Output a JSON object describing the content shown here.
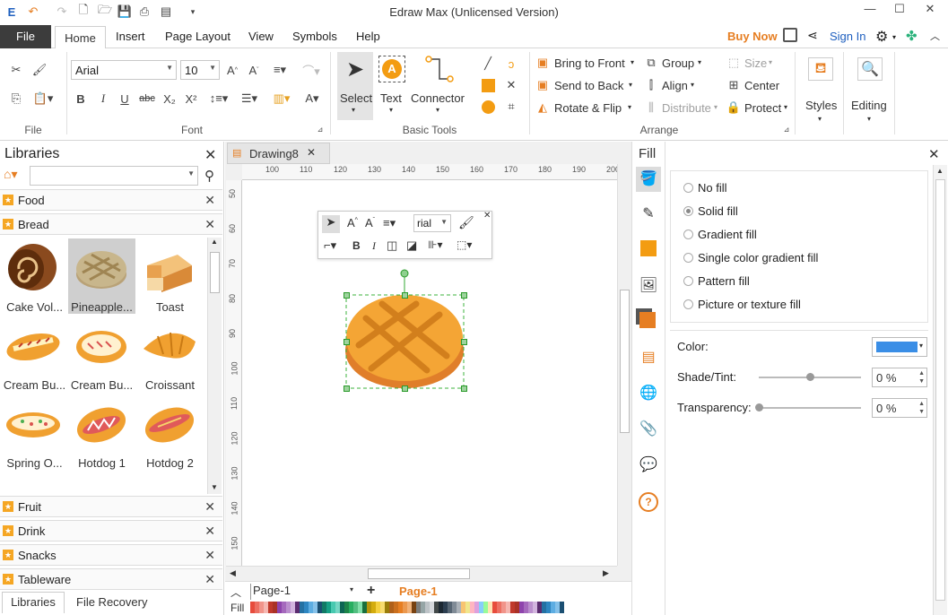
{
  "window": {
    "title": "Edraw Max (Unlicensed Version)"
  },
  "menu": {
    "file": "File",
    "tabs": [
      "Home",
      "Insert",
      "Page Layout",
      "View",
      "Symbols",
      "Help"
    ],
    "buy_now": "Buy Now",
    "sign_in": "Sign In"
  },
  "ribbon": {
    "file_group": "File",
    "font": {
      "family": "Arial",
      "size": "10",
      "group_label": "Font"
    },
    "basic_tools": {
      "select": "Select",
      "text": "Text",
      "connector": "Connector",
      "group_label": "Basic Tools"
    },
    "arrange": {
      "bring_front": "Bring to Front",
      "send_back": "Send to Back",
      "rotate_flip": "Rotate & Flip",
      "group": "Group",
      "align": "Align",
      "distribute": "Distribute",
      "size": "Size",
      "center": "Center",
      "protect": "Protect",
      "group_label": "Arrange"
    },
    "styles": "Styles",
    "editing": "Editing"
  },
  "libraries": {
    "title": "Libraries",
    "search_placeholder": "",
    "categories_top": [
      "Food",
      "Bread"
    ],
    "shapes": [
      {
        "label": "Cake Vol...",
        "icon": "cake-roll-icon"
      },
      {
        "label": "Pineapple...",
        "icon": "pineapple-bun-icon"
      },
      {
        "label": "Toast",
        "icon": "toast-icon"
      },
      {
        "label": "Cream Bu...",
        "icon": "cream-bun-icon"
      },
      {
        "label": "Cream Bu...",
        "icon": "cream-bun-2-icon"
      },
      {
        "label": "Croissant",
        "icon": "croissant-icon"
      },
      {
        "label": "Spring O...",
        "icon": "spring-onion-bun-icon"
      },
      {
        "label": "Hotdog 1",
        "icon": "hotdog-1-icon"
      },
      {
        "label": "Hotdog 2",
        "icon": "hotdog-2-icon"
      }
    ],
    "categories_bottom": [
      "Fruit",
      "Drink",
      "Snacks",
      "Tableware"
    ],
    "bottom_tabs": [
      "Libraries",
      "File Recovery"
    ]
  },
  "document": {
    "tab": "Drawing8",
    "ruler_h": [
      "100",
      "110",
      "120",
      "130",
      "140",
      "150",
      "160",
      "170",
      "180",
      "190",
      "200"
    ],
    "ruler_v": [
      "50",
      "60",
      "70",
      "80",
      "90",
      "100",
      "110",
      "120",
      "130",
      "140",
      "150"
    ],
    "float_toolbar": {
      "font": "rial"
    },
    "page_select": "Page-1",
    "page_tab": "Page-1",
    "fill_label": "Fill"
  },
  "fill_panel": {
    "title": "Fill",
    "options": [
      "No fill",
      "Solid fill",
      "Gradient fill",
      "Single color gradient fill",
      "Pattern fill",
      "Picture or texture fill"
    ],
    "selected_option": "Solid fill",
    "color_label": "Color:",
    "color_value": "#3a8ee6",
    "shade_label": "Shade/Tint:",
    "shade_value": "0 %",
    "shade_level": 0.5,
    "transparency_label": "Transparency:",
    "transparency_value": "0 %",
    "transparency_level": 0
  },
  "colors": {
    "accent_orange": "#f39c12",
    "buy_now": "#e67e22",
    "link_blue": "#1e5fbf"
  }
}
